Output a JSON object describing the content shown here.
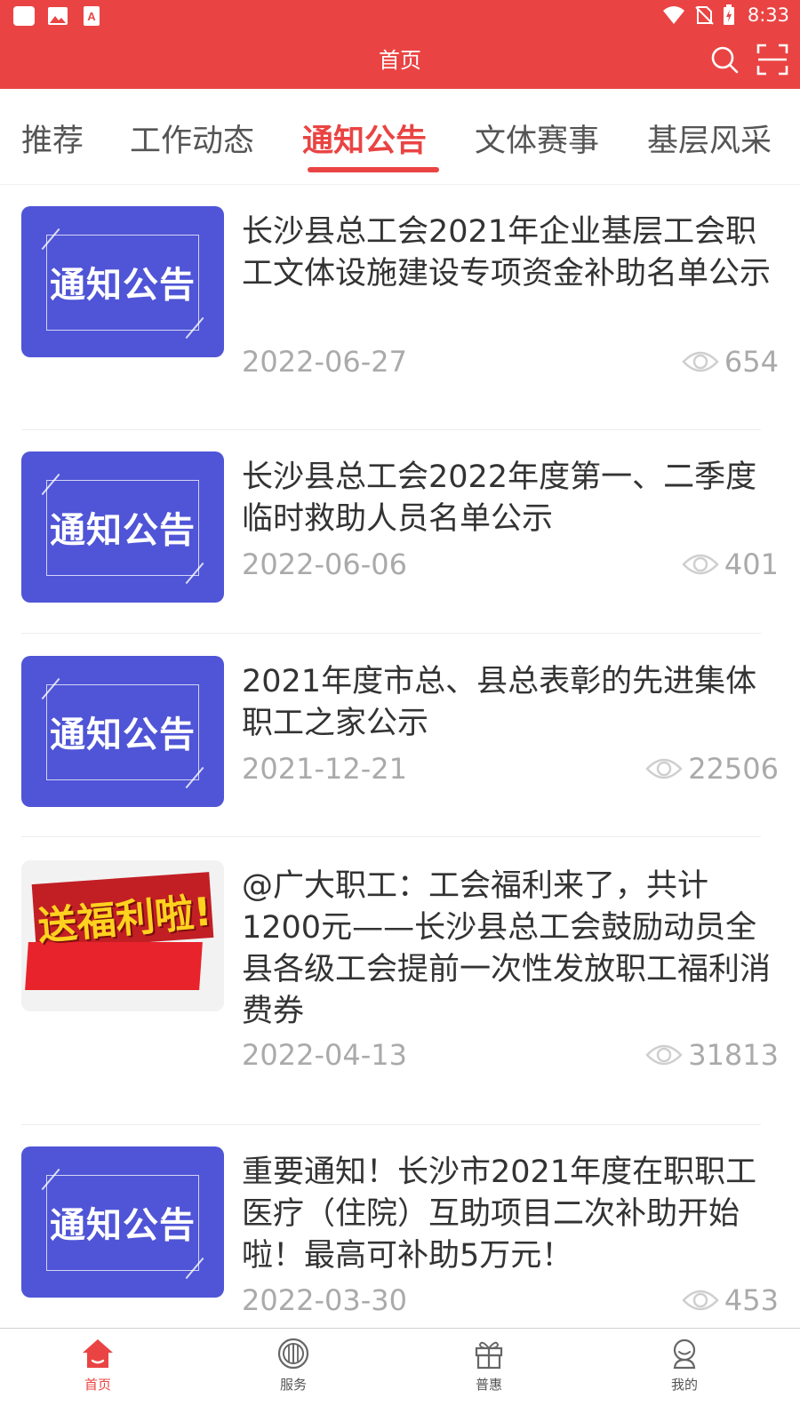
{
  "status_bar": {
    "time": "8:33"
  },
  "header": {
    "title": "首页"
  },
  "tabs": [
    {
      "label": "推荐"
    },
    {
      "label": "工作动态"
    },
    {
      "label": "通知公告"
    },
    {
      "label": "文体赛事"
    },
    {
      "label": "基层风采"
    }
  ],
  "active_tab": "通知公告",
  "articles": [
    {
      "thumb_text": "通知公告",
      "title": "长沙县总工会2021年企业基层工会职工文体设施建设专项资金补助名单公示",
      "date": "2022-06-27",
      "views": "654"
    },
    {
      "thumb_text": "通知公告",
      "title": "长沙县总工会2022年度第一、二季度临时救助人员名单公示",
      "date": "2022-06-06",
      "views": "401"
    },
    {
      "thumb_text": "通知公告",
      "title": "2021年度市总、县总表彰的先进集体职工之家公示",
      "date": "2021-12-21",
      "views": "22506"
    },
    {
      "thumb_text": "送福利啦!",
      "title": "@广大职工：工会福利来了，共计1200元——长沙县总工会鼓励动员全县各级工会提前一次性发放职工福利消费券",
      "date": "2022-04-13",
      "views": "31813"
    },
    {
      "thumb_text": "通知公告",
      "title": "重要通知！长沙市2021年度在职职工医疗（住院）互助项目二次补助开始啦！最高可补助5万元！",
      "date": "2022-03-30",
      "views": "453"
    }
  ],
  "bottom_nav": [
    {
      "label": "首页",
      "icon": "home-icon"
    },
    {
      "label": "服务",
      "icon": "union-logo-icon"
    },
    {
      "label": "普惠",
      "icon": "gift-icon"
    },
    {
      "label": "我的",
      "icon": "profile-icon"
    }
  ],
  "colors": {
    "brand_red": "#e94443",
    "thumb_blue": "#4f55d6",
    "meta_gray": "#aaaaaa"
  }
}
